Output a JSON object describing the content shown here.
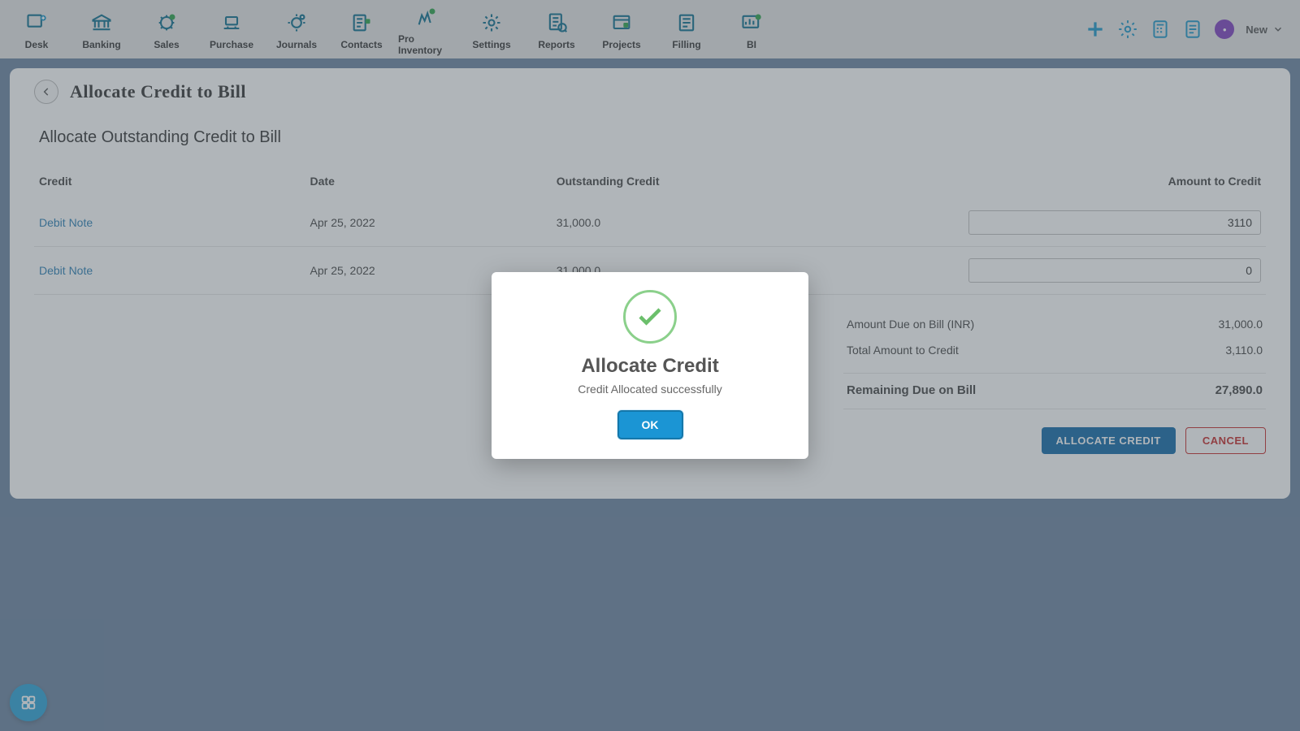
{
  "nav": {
    "items": [
      {
        "label": "Desk"
      },
      {
        "label": "Banking"
      },
      {
        "label": "Sales"
      },
      {
        "label": "Purchase"
      },
      {
        "label": "Journals"
      },
      {
        "label": "Contacts"
      },
      {
        "label": "Pro Inventory"
      },
      {
        "label": "Settings"
      },
      {
        "label": "Reports"
      },
      {
        "label": "Projects"
      },
      {
        "label": "Filling"
      },
      {
        "label": "BI"
      }
    ],
    "new_label": "New"
  },
  "page": {
    "title": "Allocate Credit to Bill",
    "section_title": "Allocate Outstanding Credit to Bill"
  },
  "table": {
    "headers": {
      "credit": "Credit",
      "date": "Date",
      "outstanding": "Outstanding Credit",
      "amount": "Amount to Credit"
    },
    "rows": [
      {
        "credit": "Debit Note",
        "date": "Apr 25, 2022",
        "outstanding": "31,000.0",
        "amount": "3110"
      },
      {
        "credit": "Debit Note",
        "date": "Apr 25, 2022",
        "outstanding": "31,000.0",
        "amount": "0"
      }
    ]
  },
  "summary": {
    "amount_due_label": "Amount Due on Bill (INR)",
    "amount_due_value": "31,000.0",
    "total_credit_label": "Total Amount to Credit",
    "total_credit_value": "3,110.0",
    "remaining_label": "Remaining Due on Bill",
    "remaining_value": "27,890.0"
  },
  "actions": {
    "allocate": "ALLOCATE CREDIT",
    "cancel": "CANCEL"
  },
  "modal": {
    "title": "Allocate Credit",
    "message": "Credit Allocated successfully",
    "ok": "OK"
  }
}
